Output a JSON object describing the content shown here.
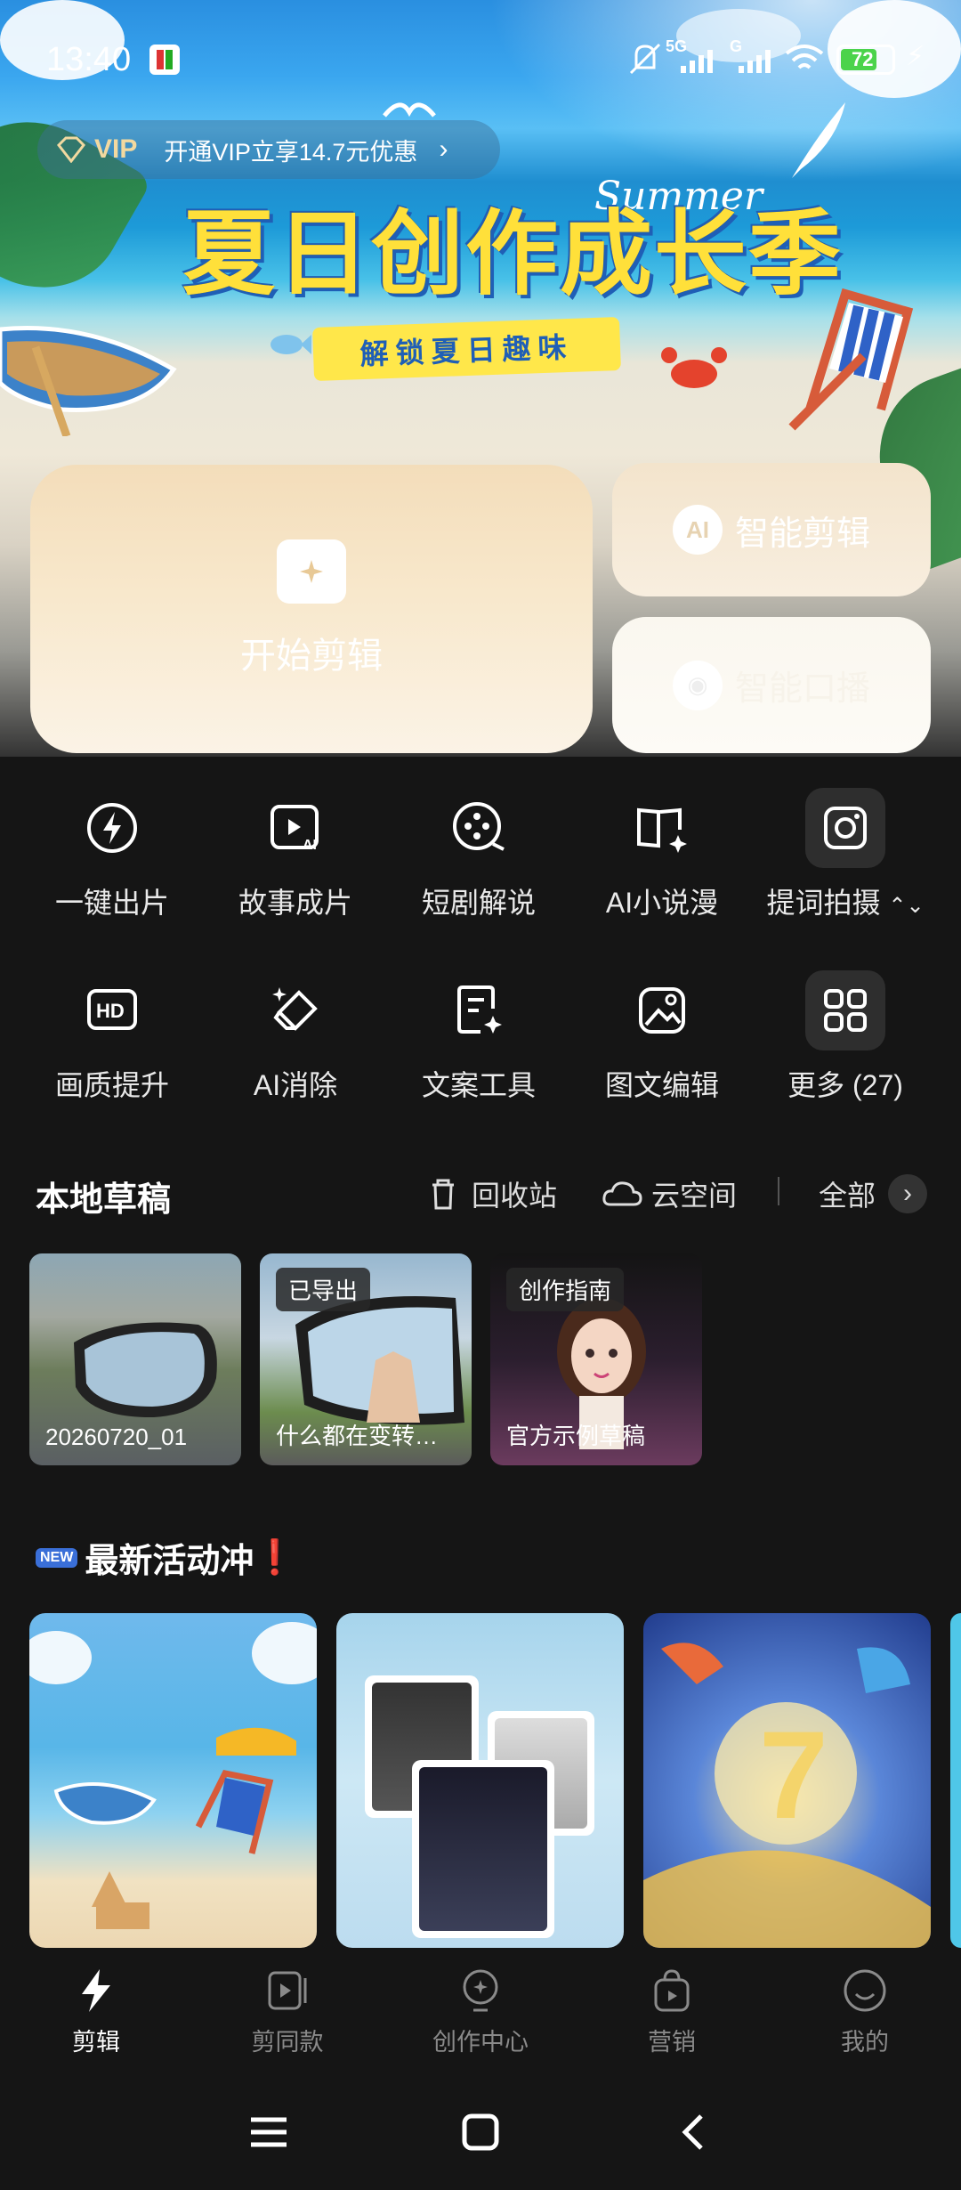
{
  "status_bar": {
    "time": "13:40",
    "network_1": "5G",
    "network_2": "G",
    "battery": "72"
  },
  "banner": {
    "vip_label": "VIP",
    "vip_promo": "开通VIP立享14.7元优惠",
    "title": "夏日创作成长季",
    "title_en": "Summer",
    "subtitle": "解锁夏日趣味"
  },
  "quick_cards": {
    "start_edit": "开始剪辑",
    "smart_edit_icon": "AI",
    "smart_edit": "智能剪辑",
    "smart_caption": "智能口播"
  },
  "tools": [
    {
      "label": "一键出片",
      "icon": "lightning-icon"
    },
    {
      "label": "故事成片",
      "icon": "story-ai-icon"
    },
    {
      "label": "短剧解说",
      "icon": "film-reel-icon"
    },
    {
      "label": "AI小说漫",
      "icon": "book-sparkle-icon"
    },
    {
      "label": "提词拍摄",
      "icon": "camera-icon"
    },
    {
      "label": "画质提升",
      "icon": "hd-icon"
    },
    {
      "label": "AI消除",
      "icon": "eraser-icon"
    },
    {
      "label": "文案工具",
      "icon": "text-edit-icon"
    },
    {
      "label": "图文编辑",
      "icon": "image-edit-icon"
    },
    {
      "label": "更多 (27)",
      "icon": "grid-icon"
    }
  ],
  "drafts": {
    "title": "本地草稿",
    "recycle": "回收站",
    "cloud": "云空间",
    "all": "全部",
    "items": [
      {
        "name": "20260720_01",
        "tag": ""
      },
      {
        "name": "什么都在变转…",
        "tag": "已导出"
      },
      {
        "name": "官方示例草稿",
        "tag": "创作指南"
      }
    ]
  },
  "activities": {
    "badge": "NEW",
    "title": "最新活动冲",
    "mark": "❗"
  },
  "bottom_nav": [
    {
      "label": "剪辑",
      "icon": "scissors-bolt-icon",
      "active": true
    },
    {
      "label": "剪同款",
      "icon": "template-icon",
      "active": false
    },
    {
      "label": "创作中心",
      "icon": "bulb-icon",
      "active": false
    },
    {
      "label": "营销",
      "icon": "bag-icon",
      "active": false
    },
    {
      "label": "我的",
      "icon": "smile-icon",
      "active": false
    }
  ],
  "colors": {
    "background": "#151515",
    "banner_yellow": "#ffe03a",
    "banner_blue": "#1f5fb6",
    "card_cream": "#f6e6c9"
  }
}
